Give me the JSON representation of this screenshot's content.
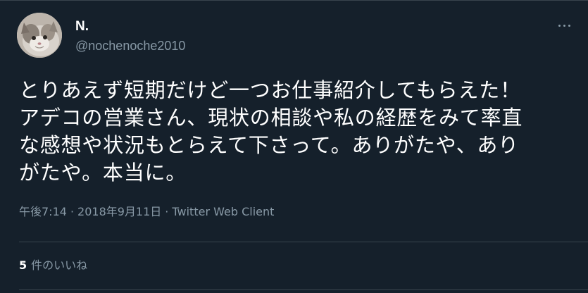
{
  "author": {
    "display_name": "N.",
    "handle": "@nochenoche2010",
    "avatar_icon": "cat-avatar-icon"
  },
  "tweet": {
    "text": "とりあえず短期だけど一つお仕事紹介してもらえた！\nアデコの営業さん、現状の相談や私の経歴をみて率直\nな感想や状況もとらえて下さって。ありがたや、あり\nがたや。本当に。"
  },
  "meta": {
    "time": "午後7:14",
    "separator": "·",
    "date": "2018年9月11日",
    "source": "Twitter Web Client"
  },
  "stats": {
    "likes_count": "5",
    "likes_label": "件のいいね"
  },
  "colors": {
    "background": "#15202b",
    "text_primary": "#ffffff",
    "text_secondary": "#8899a6",
    "border": "#38444d"
  }
}
